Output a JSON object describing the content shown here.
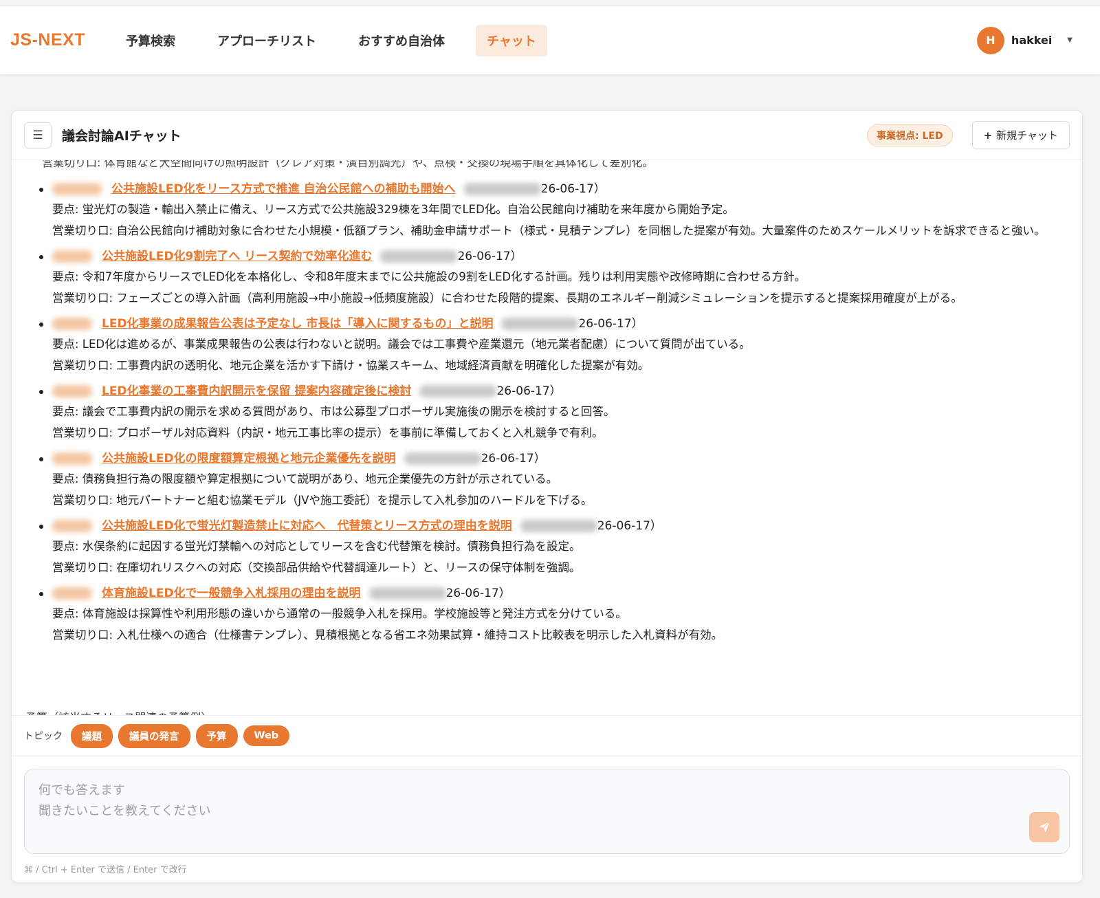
{
  "navbar": {
    "brand": "JS-NEXT",
    "items": [
      {
        "label": "予算検索"
      },
      {
        "label": "アプローチリスト"
      },
      {
        "label": "おすすめ自治体"
      },
      {
        "label": "チャット"
      }
    ],
    "active_item": "チャット",
    "user": {
      "initial": "H",
      "name": "hakkei"
    }
  },
  "chat": {
    "title": "議会討論AIチャット",
    "focus_badge": "事業視点: LED",
    "new_chat_label": "新規チャット",
    "clipped_top_text": "営業切り口: 体育館など大空間向けの照明設計（グレア対策・演目別調光）や、点検・交換の現場手順を具体化して差別化。",
    "results": [
      {
        "link": "公共施設LED化をリース方式で推進 自治公民館への補助も開始へ",
        "date": "26-06-17）",
        "point": "要点: 蛍光灯の製造・輸出入禁止に備え、リース方式で公共施設329棟を3年間でLED化。自治公民館向け補助を来年度から開始予定。",
        "sales": "営業切り口: 自治公民館向け補助対象に合わせた小規模・低額プラン、補助金申請サポート（様式・見積テンプレ）を同梱した提案が有効。大量案件のためスケールメリットを訴求できると強い。"
      },
      {
        "link": "公共施設LED化9割完了へ リース契約で効率化進む",
        "date": "26-06-17）",
        "point": "要点: 令和7年度からリースでLED化を本格化し、令和8年度末までに公共施設の9割をLED化する計画。残りは利用実態や改修時期に合わせる方針。",
        "sales": "営業切り口: フェーズごとの導入計画（高利用施設→中小施設→低頻度施設）に合わせた段階的提案、長期のエネルギー削減シミュレーションを提示すると提案採用確度が上がる。"
      },
      {
        "link": "LED化事業の成果報告公表は予定なし 市長は「導入に関するもの」と説明",
        "date": "26-06-17）",
        "point": "要点: LED化は進めるが、事業成果報告の公表は行わないと説明。議会では工事費や産業還元（地元業者配慮）について質問が出ている。",
        "sales": "営業切り口: 工事費内訳の透明化、地元企業を活かす下請け・協業スキーム、地域経済貢献を明確化した提案が有効。"
      },
      {
        "link": "LED化事業の工事費内訳開示を保留 提案内容確定後に検討",
        "date": "26-06-17）",
        "point": "要点: 議会で工事費内訳の開示を求める質問があり、市は公募型プロポーザル実施後の開示を検討すると回答。",
        "sales": "営業切り口: プロポーザル対応資料（内訳・地元工事比率の提示）を事前に準備しておくと入札競争で有利。"
      },
      {
        "link": "公共施設LED化の限度額算定根拠と地元企業優先を説明",
        "date": "26-06-17）",
        "point": "要点: 債務負担行為の限度額や算定根拠について説明があり、地元企業優先の方針が示されている。",
        "sales": "営業切り口: 地元パートナーと組む協業モデル（JVや施工委託）を提示して入札参加のハードルを下げる。"
      },
      {
        "link": "公共施設LED化で蛍光灯製造禁止に対応へ　代替策とリース方式の理由を説明",
        "date": "26-06-17）",
        "point": "要点: 水俣条約に起因する蛍光灯禁輸への対応としてリースを含む代替策を検討。債務負担行為を設定。",
        "sales": "営業切り口: 在庫切れリスクへの対応（交換部品供給や代替調達ルート）と、リースの保守体制を強調。"
      },
      {
        "link": "体育施設LED化で一般競争入札採用の理由を説明",
        "date": "26-06-17）",
        "point": "要点: 体育施設は採算性や利用形態の違いから通常の一般競争入札を採用。学校施設等と発注方式を分けている。",
        "sales": "営業切り口: 入札仕様への適合（仕様書テンプレ）、見積根拠となる省エネ効果試算・維持コスト比較表を明示した入札資料が有効。"
      }
    ],
    "clipped_bottom_text": "予算（該当するリース関連の予算例）"
  },
  "topics": {
    "label": "トピック",
    "chips": [
      "議題",
      "議員の発言",
      "予算",
      "Web"
    ]
  },
  "composer": {
    "placeholder_line1": "何でも答えます",
    "placeholder_line2": "聞きたいことを教えてください",
    "hint": "⌘ / Ctrl + Enter で送信 / Enter で改行"
  },
  "colors": {
    "accent": "#e8782f",
    "accent_light": "#fcebdd",
    "send_disabled": "#f7c5a3"
  },
  "icons": [
    "hamburger-menu-icon",
    "plus-icon",
    "chevron-down-icon",
    "send-icon"
  ]
}
